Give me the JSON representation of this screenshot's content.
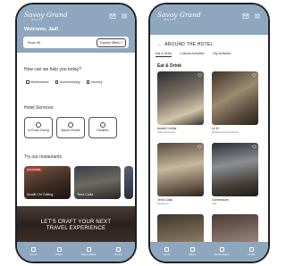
{
  "brand": {
    "name": "Savoy Grand",
    "tagline": "HOTEL",
    "header_color": "#8ea7bf"
  },
  "home": {
    "welcome": "Welcome, Jad!",
    "room_label": "Room 58",
    "offers_label": "Explore Offers",
    "help_title": "How can we help you today?",
    "chips": [
      "Maintenance",
      "Housekeeping",
      "Laundry"
    ],
    "services_title": "Hotel Services:",
    "services": [
      "In-Room Dining",
      "Airport Shuttle",
      "Facilities"
    ],
    "restaurants_title": "Try our restaurants",
    "restaurants": [
      {
        "name": "Amalfi Chi Grilling",
        "badge": "EXCLUSIVE"
      },
      {
        "name": "Terra Cotta",
        "badge": ""
      }
    ],
    "banner_line1": "LET'S CRAFT YOUR NEXT",
    "banner_line2": "TRAVEL EXPERIENCE",
    "nav": [
      "Home",
      "Offers",
      "Reservations",
      "Profile"
    ]
  },
  "around": {
    "title": "AROUND THE HOTEL",
    "tabs": [
      "Eat & Drink",
      "Cultural Activities",
      "City Activities"
    ],
    "active_tab": "Eat & Drink",
    "category": "Eat & Drink",
    "places": [
      {
        "name": "Amalfi Chi Bar",
        "subtitle": "Italian Restaurant"
      },
      {
        "name": "Le M",
        "subtitle": "Mediterranean Restaurant"
      },
      {
        "name": "Terra Cotta",
        "subtitle": "Restaurant"
      },
      {
        "name": "Cornerstone",
        "subtitle": "Cafe"
      },
      {
        "name": "",
        "subtitle": ""
      },
      {
        "name": "",
        "subtitle": ""
      }
    ],
    "nav": [
      "Home",
      "Offers",
      "Reservations",
      "Profile"
    ]
  }
}
